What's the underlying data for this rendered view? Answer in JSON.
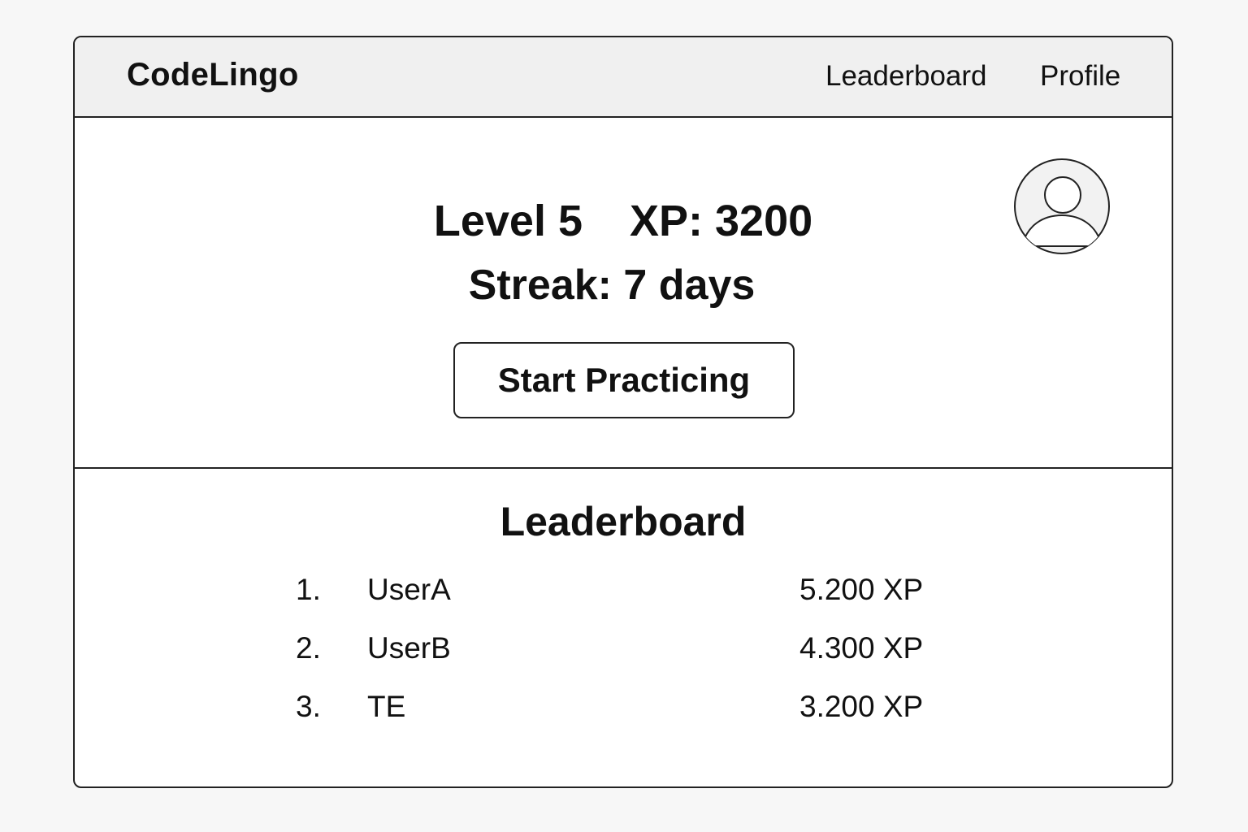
{
  "header": {
    "brand": "CodeLingo",
    "nav": {
      "leaderboard": "Leaderboard",
      "profile": "Profile"
    }
  },
  "hero": {
    "level": "Level 5",
    "xp": "XP: 3200",
    "streak": "Streak: 7 days",
    "start_button": "Start Practicing",
    "avatar_icon": "user-avatar-icon"
  },
  "leaderboard": {
    "title": "Leaderboard",
    "rows": [
      {
        "rank": "1.",
        "name": "UserA",
        "xp": "5.200 XP"
      },
      {
        "rank": "2.",
        "name": "UserB",
        "xp": "4.300 XP"
      },
      {
        "rank": "3.",
        "name": "TE",
        "xp": "3.200 XP"
      }
    ]
  }
}
